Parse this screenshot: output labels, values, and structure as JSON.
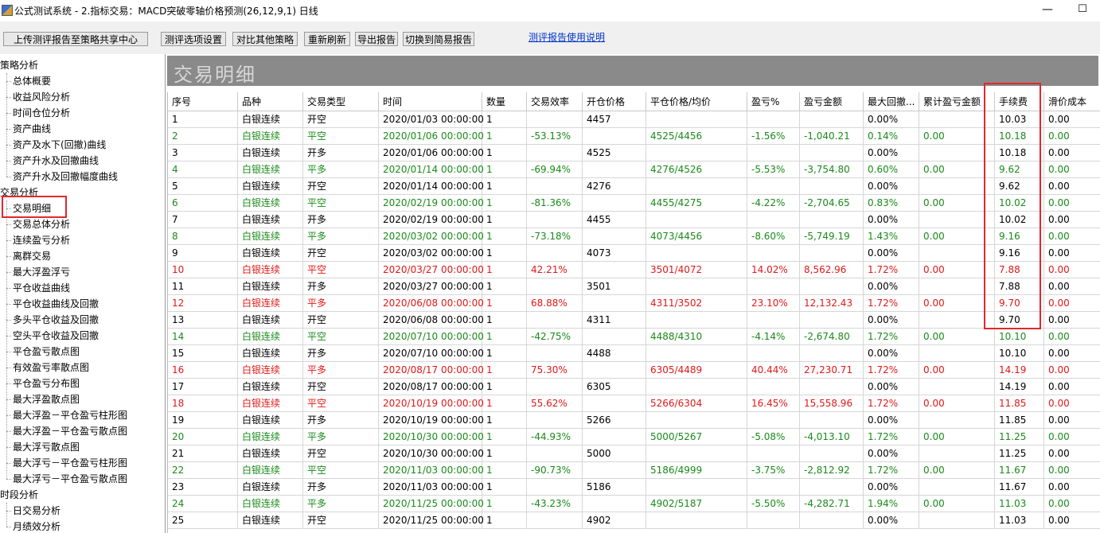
{
  "window": {
    "title": "公式测试系统 - 2.指标交易：MACD突破零轴价格预测(26,12,9,1) 日线",
    "minimize": "—",
    "maximize": "☐"
  },
  "toolbar": {
    "upload": "上传测评报告至策略共享中心",
    "settings": "测评选项设置",
    "compare": "对比其他策略",
    "refresh": "重新刷新",
    "export": "导出报告",
    "switch": "切换到简易报告",
    "help": "测评报告使用说明"
  },
  "sidebar": {
    "groups": [
      {
        "label": "策略分析",
        "items": [
          "总体概要",
          "收益风险分析",
          "时间仓位分析",
          "资产曲线",
          "资产及水下(回撤)曲线",
          "资产升水及回撤曲线",
          "资产升水及回撤幅度曲线"
        ]
      },
      {
        "label": "交易分析",
        "items": [
          "交易明细",
          "交易总体分析",
          "连续盈亏分析",
          "离群交易",
          "最大浮盈浮亏",
          "平仓收益曲线",
          "平仓收益曲线及回撤",
          "多头平仓收益及回撤",
          "空头平仓收益及回撤",
          "平仓盈亏散点图",
          "有效盈亏率散点图",
          "平仓盈亏分布图",
          "最大浮盈散点图",
          "最大浮盈－平仓盈亏柱形图",
          "最大浮盈－平仓盈亏散点图",
          "最大浮亏散点图",
          "最大浮亏－平仓盈亏柱形图",
          "最大浮亏－平仓盈亏散点图"
        ]
      },
      {
        "label": "时段分析",
        "items": [
          "日交易分析",
          "月绩效分析"
        ]
      }
    ],
    "selected": "交易明细"
  },
  "main": {
    "title": "交易明细",
    "columns": [
      "序号",
      "品种",
      "交易类型",
      "时间",
      "数量",
      "交易效率",
      "开仓价格",
      "平仓价格/均价",
      "盈亏%",
      "盈亏金额",
      "最大回撤...",
      "累计盈亏金额",
      "手续费",
      "滑价成本"
    ],
    "rows": [
      {
        "color": "black",
        "cells": [
          "1",
          "白银连续",
          "开空",
          "2020/01/03 00:00:00",
          "1",
          "",
          "4457",
          "",
          "",
          "",
          "0.00%",
          "",
          "10.03",
          "0.00"
        ]
      },
      {
        "color": "green",
        "cells": [
          "2",
          "白银连续",
          "平空",
          "2020/01/06 00:00:00",
          "1",
          "-53.13%",
          "",
          "4525/4456",
          "-1.56%",
          "-1,040.21",
          "0.14%",
          "0.00",
          "10.18",
          "0.00"
        ]
      },
      {
        "color": "black",
        "cells": [
          "3",
          "白银连续",
          "开多",
          "2020/01/06 00:00:00",
          "1",
          "",
          "4525",
          "",
          "",
          "",
          "0.00%",
          "",
          "10.18",
          "0.00"
        ]
      },
      {
        "color": "green",
        "cells": [
          "4",
          "白银连续",
          "平多",
          "2020/01/14 00:00:00",
          "1",
          "-69.94%",
          "",
          "4276/4526",
          "-5.53%",
          "-3,754.80",
          "0.60%",
          "0.00",
          "9.62",
          "0.00"
        ]
      },
      {
        "color": "black",
        "cells": [
          "5",
          "白银连续",
          "开空",
          "2020/01/14 00:00:00",
          "1",
          "",
          "4276",
          "",
          "",
          "",
          "0.00%",
          "",
          "9.62",
          "0.00"
        ]
      },
      {
        "color": "green",
        "cells": [
          "6",
          "白银连续",
          "平空",
          "2020/02/19 00:00:00",
          "1",
          "-81.36%",
          "",
          "4455/4275",
          "-4.22%",
          "-2,704.65",
          "0.83%",
          "0.00",
          "10.02",
          "0.00"
        ]
      },
      {
        "color": "black",
        "cells": [
          "7",
          "白银连续",
          "开多",
          "2020/02/19 00:00:00",
          "1",
          "",
          "4455",
          "",
          "",
          "",
          "0.00%",
          "",
          "10.02",
          "0.00"
        ]
      },
      {
        "color": "green",
        "cells": [
          "8",
          "白银连续",
          "平多",
          "2020/03/02 00:00:00",
          "1",
          "-73.18%",
          "",
          "4073/4456",
          "-8.60%",
          "-5,749.19",
          "1.43%",
          "0.00",
          "9.16",
          "0.00"
        ]
      },
      {
        "color": "black",
        "cells": [
          "9",
          "白银连续",
          "开空",
          "2020/03/02 00:00:00",
          "1",
          "",
          "4073",
          "",
          "",
          "",
          "0.00%",
          "",
          "9.16",
          "0.00"
        ]
      },
      {
        "color": "red",
        "cells": [
          "10",
          "白银连续",
          "平空",
          "2020/03/27 00:00:00",
          "1",
          "42.21%",
          "",
          "3501/4072",
          "14.02%",
          "8,562.96",
          "1.72%",
          "0.00",
          "7.88",
          "0.00"
        ]
      },
      {
        "color": "black",
        "cells": [
          "11",
          "白银连续",
          "开多",
          "2020/03/27 00:00:00",
          "1",
          "",
          "3501",
          "",
          "",
          "",
          "0.00%",
          "",
          "7.88",
          "0.00"
        ]
      },
      {
        "color": "red",
        "cells": [
          "12",
          "白银连续",
          "平多",
          "2020/06/08 00:00:00",
          "1",
          "68.88%",
          "",
          "4311/3502",
          "23.10%",
          "12,132.43",
          "1.72%",
          "0.00",
          "9.70",
          "0.00"
        ]
      },
      {
        "color": "black",
        "cells": [
          "13",
          "白银连续",
          "开空",
          "2020/06/08 00:00:00",
          "1",
          "",
          "4311",
          "",
          "",
          "",
          "0.00%",
          "",
          "9.70",
          "0.00"
        ]
      },
      {
        "color": "green",
        "cells": [
          "14",
          "白银连续",
          "平空",
          "2020/07/10 00:00:00",
          "1",
          "-42.75%",
          "",
          "4488/4310",
          "-4.14%",
          "-2,674.80",
          "1.72%",
          "0.00",
          "10.10",
          "0.00"
        ]
      },
      {
        "color": "black",
        "cells": [
          "15",
          "白银连续",
          "开多",
          "2020/07/10 00:00:00",
          "1",
          "",
          "4488",
          "",
          "",
          "",
          "0.00%",
          "",
          "10.10",
          "0.00"
        ]
      },
      {
        "color": "red",
        "cells": [
          "16",
          "白银连续",
          "平多",
          "2020/08/17 00:00:00",
          "1",
          "75.30%",
          "",
          "6305/4489",
          "40.44%",
          "27,230.71",
          "1.72%",
          "0.00",
          "14.19",
          "0.00"
        ]
      },
      {
        "color": "black",
        "cells": [
          "17",
          "白银连续",
          "开空",
          "2020/08/17 00:00:00",
          "1",
          "",
          "6305",
          "",
          "",
          "",
          "0.00%",
          "",
          "14.19",
          "0.00"
        ]
      },
      {
        "color": "red",
        "cells": [
          "18",
          "白银连续",
          "平空",
          "2020/10/19 00:00:00",
          "1",
          "55.62%",
          "",
          "5266/6304",
          "16.45%",
          "15,558.96",
          "1.72%",
          "0.00",
          "11.85",
          "0.00"
        ]
      },
      {
        "color": "black",
        "cells": [
          "19",
          "白银连续",
          "开多",
          "2020/10/19 00:00:00",
          "1",
          "",
          "5266",
          "",
          "",
          "",
          "0.00%",
          "",
          "11.85",
          "0.00"
        ]
      },
      {
        "color": "green",
        "cells": [
          "20",
          "白银连续",
          "平多",
          "2020/10/30 00:00:00",
          "1",
          "-44.93%",
          "",
          "5000/5267",
          "-5.08%",
          "-4,013.10",
          "1.72%",
          "0.00",
          "11.25",
          "0.00"
        ]
      },
      {
        "color": "black",
        "cells": [
          "21",
          "白银连续",
          "开空",
          "2020/10/30 00:00:00",
          "1",
          "",
          "5000",
          "",
          "",
          "",
          "0.00%",
          "",
          "11.25",
          "0.00"
        ]
      },
      {
        "color": "green",
        "cells": [
          "22",
          "白银连续",
          "平空",
          "2020/11/03 00:00:00",
          "1",
          "-90.73%",
          "",
          "5186/4999",
          "-3.75%",
          "-2,812.92",
          "1.72%",
          "0.00",
          "11.67",
          "0.00"
        ]
      },
      {
        "color": "black",
        "cells": [
          "23",
          "白银连续",
          "开多",
          "2020/11/03 00:00:00",
          "1",
          "",
          "5186",
          "",
          "",
          "",
          "0.00%",
          "",
          "11.67",
          "0.00"
        ]
      },
      {
        "color": "green",
        "cells": [
          "24",
          "白银连续",
          "平多",
          "2020/11/25 00:00:00",
          "1",
          "-43.23%",
          "",
          "4902/5187",
          "-5.50%",
          "-4,282.71",
          "1.94%",
          "0.00",
          "11.03",
          "0.00"
        ]
      },
      {
        "color": "black",
        "cells": [
          "25",
          "白银连续",
          "开空",
          "2020/11/25 00:00:00",
          "1",
          "",
          "4902",
          "",
          "",
          "",
          "0.00%",
          "",
          "11.03",
          "0.00"
        ]
      }
    ]
  },
  "colors": {
    "highlight_box": "#e0282d",
    "profit": "#e01818",
    "loss": "#1a8a1a",
    "header_bar": "#8a8a8a",
    "link": "#0033cc"
  }
}
